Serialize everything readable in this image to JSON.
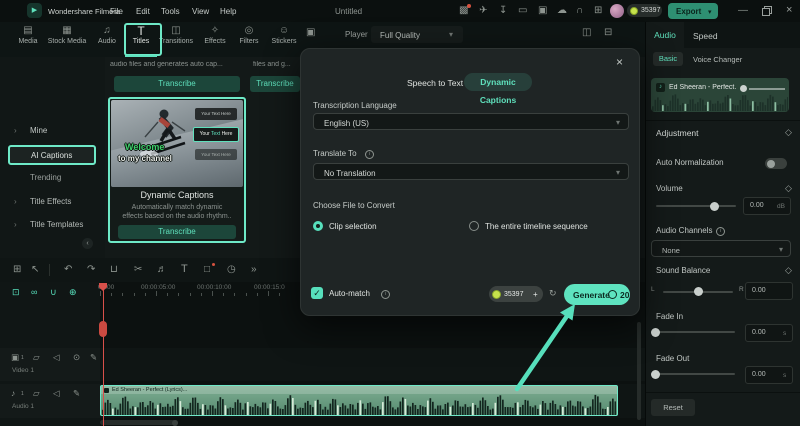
{
  "icons": {
    "logo": "▶",
    "gift": "▩",
    "send": "✈",
    "export_media": "↧",
    "display": "▭",
    "save": "▣",
    "cloud": "☁",
    "support": "∩",
    "workspace": "⊞",
    "chevron_down": "▾",
    "chevron_right": "›",
    "chevron_left": "‹",
    "minimize": "—",
    "close": "×",
    "tab_media": "▤",
    "tab_stock": "▦",
    "tab_audio": "♫",
    "tab_titles": "T",
    "tab_transitions": "◫",
    "tab_effects": "✧",
    "tab_filters": "◎",
    "tab_stickers": "☺",
    "tab_more": "▣",
    "player_split": "◫",
    "player_mark": "⊟",
    "grid": "⊞",
    "pointer": "↖",
    "undo": "↶",
    "redo": "↷",
    "trash": "⊔",
    "split": "✂",
    "note": "♬",
    "text_tool": "T",
    "crop": "□",
    "clock": "◷",
    "more": "»",
    "track_manage": "⊡",
    "link": "∞",
    "magnet": "∪",
    "snap": "⊕",
    "video": "▣",
    "folder": "▱",
    "speaker": "◁",
    "eye": "⊙",
    "pen": "✎",
    "music": "♪",
    "diamond": "◇",
    "refresh": "↻",
    "check": "✓",
    "info": "i"
  },
  "titlebar": {
    "app_name": "Wondershare Filmora",
    "menus": [
      "File",
      "Edit",
      "Tools",
      "View",
      "Help"
    ],
    "document_title": "Untitled",
    "credits": "35397",
    "export_label": "Export"
  },
  "media_bar": {
    "tabs": [
      "Media",
      "Stock Media",
      "Audio",
      "Titles",
      "Transitions",
      "Effects",
      "Filters",
      "Stickers"
    ],
    "active_tab": "Titles"
  },
  "player": {
    "label": "Player",
    "quality": "Full Quality"
  },
  "sidebar": {
    "items": [
      "Mine",
      "AI Captions",
      "Trending",
      "Title Effects",
      "Title Templates"
    ],
    "selected": "AI Captions"
  },
  "library": {
    "card1_desc": "audio files and generates auto cap...",
    "card1_button": "Transcribe",
    "card2_desc": "files and g...",
    "card": {
      "overlay_title": "Welcome",
      "overlay_subtitle": "to my channel",
      "caption_sample_1": "Your Text Here",
      "caption_sample_2_a": "Your",
      "caption_sample_2_b": "Text",
      "caption_sample_2_c": "Here",
      "caption_sample_3": "Your Text Here",
      "title": "Dynamic Captions",
      "desc_line1": "Automatically match dynamic",
      "desc_line2": "effects based on the audio rhythm..",
      "button": "Transcribe"
    }
  },
  "dialog": {
    "tab1": "Speech to Text",
    "tab2": "Dynamic Captions",
    "transcription_language_label": "Transcription Language",
    "transcription_language_value": "English (US)",
    "translate_label": "Translate To",
    "translate_value": "No Translation",
    "choose_file_label": "Choose File to Convert",
    "radio_clip": "Clip selection",
    "radio_timeline": "The entire timeline sequence",
    "automatch_label": "Auto-match",
    "credits": "35397",
    "credits_plus": "+",
    "generate_label": "Generate",
    "generate_cost": "20"
  },
  "audio_panel": {
    "tab_audio": "Audio",
    "tab_speed": "Speed",
    "subtab_basic": "Basic",
    "subtab_voice": "Voice Changer",
    "clip_title": "Ed Sheeran - Perfect...",
    "adjustment": "Adjustment",
    "auto_normalization": "Auto Normalization",
    "volume_label": "Volume",
    "volume_value": "0.00",
    "volume_unit": "dB",
    "audio_channels_label": "Audio Channels",
    "audio_channels_value": "None",
    "sound_balance_label": "Sound Balance",
    "balance_left": "L",
    "balance_right": "R",
    "balance_value": "0.00",
    "fade_in_label": "Fade In",
    "fade_in_value": "0.00",
    "fade_out_label": "Fade Out",
    "fade_out_value": "0.00",
    "fade_unit": "s",
    "reset_label": "Reset"
  },
  "timeline": {
    "ruler": [
      "00:00",
      "00:00:05:00",
      "00:00:10:00",
      "00:00:15:0"
    ],
    "video_track": "Video 1",
    "audio_track": "Audio 1",
    "clip_label": "Ed Sheeran - Perfect (Lyrics)..."
  }
}
